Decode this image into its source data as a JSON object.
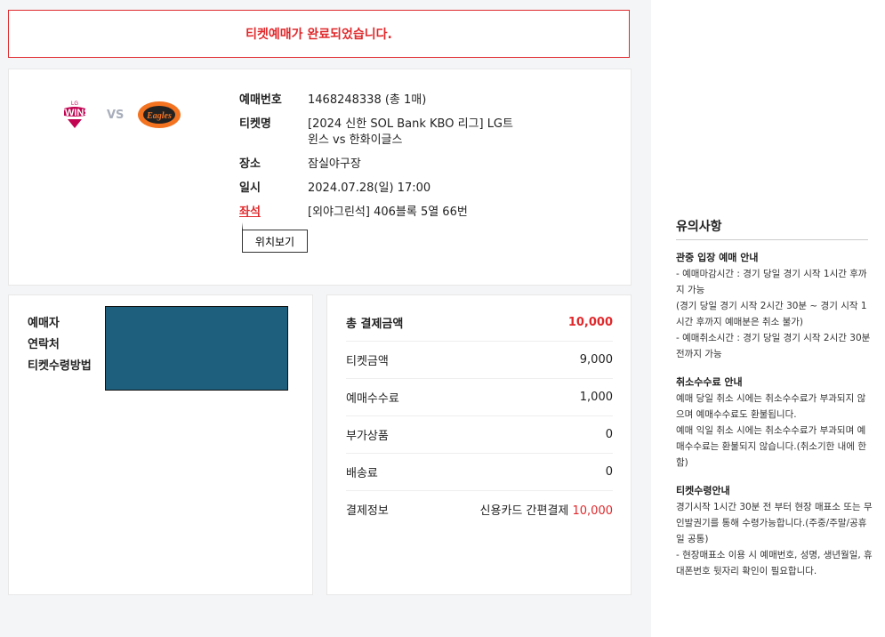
{
  "banner": {
    "message": "티켓예매가 완료되었습니다."
  },
  "match": {
    "home_logo": "TWINS",
    "home_logo_sub": "LG",
    "vs": "VS",
    "away_logo": "Eagles",
    "rows": [
      {
        "label": "예매번호",
        "value": "1468248338 (총 1매)"
      },
      {
        "label": "티켓명",
        "value": "[2024 신한 SOL Bank KBO 리그] LG트윈스 vs 한화이글스"
      },
      {
        "label": "장소",
        "value": "잠실야구장"
      },
      {
        "label": "일시",
        "value": "2024.07.28(일) 17:00"
      },
      {
        "label": "좌석",
        "value": "[외야그린석] 406블록 5열 66번"
      }
    ],
    "location_button": "위치보기"
  },
  "buyer": {
    "labels": [
      "예매자",
      "연락처",
      "티켓수령방법"
    ]
  },
  "payment": {
    "rows": [
      {
        "label": "총 결제금액",
        "value": "10,000"
      },
      {
        "label": "티켓금액",
        "value": "9,000"
      },
      {
        "label": "예매수수료",
        "value": "1,000"
      },
      {
        "label": "부가상품",
        "value": "0"
      },
      {
        "label": "배송료",
        "value": "0"
      }
    ],
    "method_label": "결제정보",
    "method_value": "신용카드 간편결제",
    "method_amount": "10,000"
  },
  "notice": {
    "title": "유의사항",
    "sections": [
      {
        "heading": "관중 입장 예매 안내",
        "lines": [
          "- 예매마감시간 : 경기 당일 경기 시작 1시간 후까지 가능",
          "(경기 당일 경기 시작 2시간 30분 ~ 경기 시작 1시간 후까지 예매분은 취소 불가)",
          "- 예매취소시간 : 경기 당일 경기 시작 2시간 30분전까지 가능"
        ]
      },
      {
        "heading": "취소수수료 안내",
        "lines": [
          "예매 당일 취소 시에는 취소수수료가 부과되지 않으며 예매수수료도 환불됩니다.",
          "예매 익일 취소 시에는 취소수수료가 부과되며 예매수수료는 환불되지 않습니다.(취소기한 내에 한함)"
        ]
      },
      {
        "heading": "티켓수령안내",
        "lines": [
          "경기시작 1시간 30분 전 부터 현장 매표소 또는 무인발권기를 통해 수령가능합니다.(주중/주말/공휴일 공통)",
          "- 현장매표소 이용 시 예매번호, 성명, 생년월일, 휴대폰번호 뒷자리 확인이 필요합니다."
        ]
      }
    ]
  },
  "colors": {
    "accent": "#e0292c",
    "mask": "#1e5f7d"
  }
}
